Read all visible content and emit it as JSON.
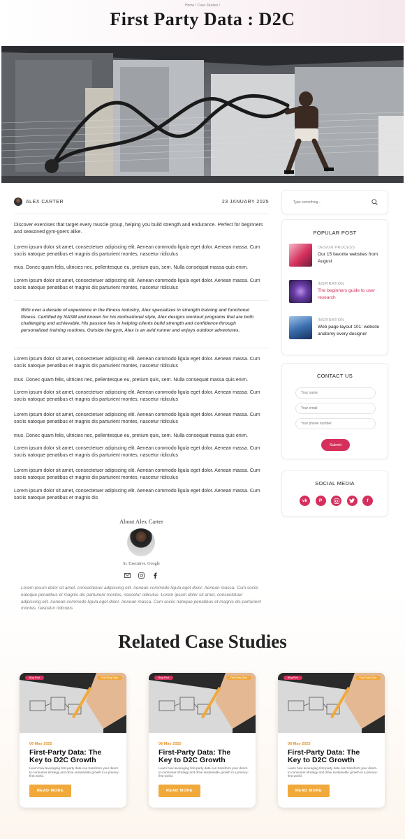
{
  "breadcrumb": "Home / Case Studies /",
  "page_title": "First Party Data : D2C",
  "author": {
    "name": "ALEX CARTER",
    "date": "23 JANUARY  2025"
  },
  "article": {
    "intro": "Discover exercises that target every muscle group, helping you build strength and endurance. Perfect for beginners and seasoned gym-goers alike.",
    "lorem": "Lorem ipsum dolor sit amet, consectetuer adipiscing elit. Aenean commodo ligula eget dolor. Aenean massa. Cum sociis natoque penatibus et magnis dis parturient montes, nascetur ridiculus",
    "mus": "mus. Donec quam felis, ultricies nec, pellentesque eu, pretium quis, sem. Nulla consequat massa quis enim.",
    "lorem_last": "Lorem ipsum dolor sit amet, consectetuer adipiscing elit. Aenean commodo ligula eget dolor. Aenean massa. Cum sociis natoque penatibus et magnis dis",
    "quote": "With over a decade of experience in the fitness industry, Alex specializes in strength training and functional fitness. Certified by NASM and known for his motivational style, Alex designs workout programs that are both challenging and achievable. His passion lies in helping clients build strength and confidence through personalized training routines. Outside the gym, Alex is an avid runner and enjoys outdoor adventures."
  },
  "about": {
    "title": "About  Alex Carter",
    "role": "Sr. Executive, Google",
    "bio": "Lorem ipsum dolor sit amet, consectetuer adipiscing elit. Aenean commodo ligula eget dolor. Aenean massa. Cum sociis natoque penatibus et magnis dis parturient montes, nascetur ridiculus. Lorem ipsum dolor sit amet, consectetuer adipiscing elit. Aenean commodo ligula eget dolor. Aenean massa. Cum sociis natoque penatibus et magnis dis parturient montes, nascetur ridiculus"
  },
  "search": {
    "placeholder": "Type something..."
  },
  "popular": {
    "title": "POPULAR POST",
    "posts": [
      {
        "category": "DESIGN PROCESS",
        "title": "Our 15 favorite websites from August"
      },
      {
        "category": "INSPIRATION",
        "title": "The beginners guide to user research"
      },
      {
        "category": "INSPIRATION",
        "title": "Web page layout 101: website anatomy every designer"
      }
    ]
  },
  "contact": {
    "title": "CONTACT US",
    "name_placeholder": "Your name",
    "email_placeholder": "Your email",
    "phone_placeholder": "Your phone number",
    "submit": "Submit"
  },
  "social": {
    "title": "SOCIAL MEDIA",
    "icons": [
      "vk-icon",
      "pinterest-icon",
      "instagram-icon",
      "twitter-icon",
      "facebook-icon"
    ]
  },
  "related": {
    "title": "Related Case Studies",
    "cards": [
      {
        "tag_left": "Blog Post",
        "tag_right": "First Party Data",
        "date": "06 May 2025",
        "title": "First-Party Data: The Key to D2C Growth",
        "desc": "Learn how leveraging first-party data can transform your direct-to-consumer strategy and drive sustainable growth in a privacy-first world.",
        "button": "READ MORE"
      },
      {
        "tag_left": "Blog Post",
        "tag_right": "First Party Data",
        "date": "06 May 2025",
        "title": "First-Party Data: The Key to D2C Growth",
        "desc": "Learn how leveraging first-party data can transform your direct-to-consumer strategy and drive sustainable growth in a privacy-first world.",
        "button": "READ MORE"
      },
      {
        "tag_left": "Blog Post",
        "tag_right": "First Party Data",
        "date": "06 May 2025",
        "title": "First-Party Data: The Key to D2C Growth",
        "desc": "Learn how leveraging first-party data can transform your direct-to-consumer strategy and drive sustainable growth in a privacy-first world.",
        "button": "READ MORE"
      }
    ]
  },
  "colors": {
    "accent_pink": "#d5305c",
    "accent_orange": "#f0a93a",
    "date_orange": "#e8922a"
  }
}
